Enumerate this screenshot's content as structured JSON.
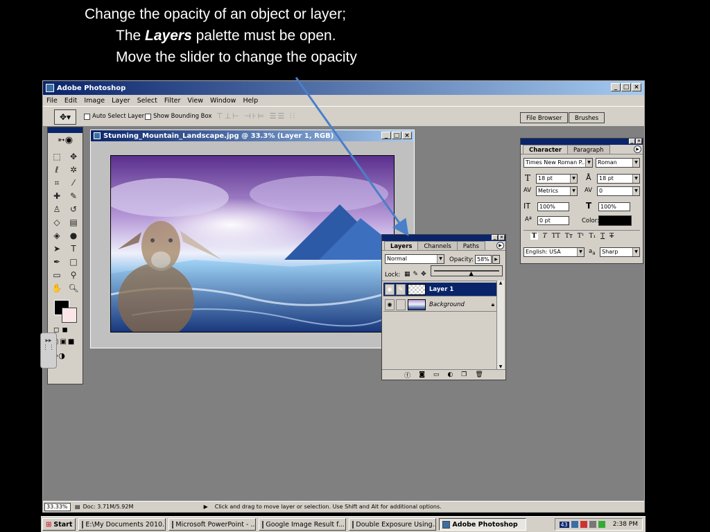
{
  "caption": {
    "line1": "Change the opacity of an object or layer;",
    "line2_prefix": "The ",
    "line2_emphasis": "Layers",
    "line2_suffix": " palette must be open.",
    "line3": "Move the slider to change the opacity"
  },
  "app": {
    "title": "Adobe Photoshop",
    "menu": [
      "File",
      "Edit",
      "Image",
      "Layer",
      "Select",
      "Filter",
      "View",
      "Window",
      "Help"
    ]
  },
  "options_bar": {
    "auto_select": "Auto Select Layer",
    "bounding_box": "Show Bounding Box",
    "tabs": [
      "File Browser",
      "Brushes"
    ]
  },
  "document": {
    "title": "Stunning_Mountain_Landscape.jpg @ 33.3% (Layer 1, RGB)"
  },
  "layers_panel": {
    "tabs": [
      "Layers",
      "Channels",
      "Paths"
    ],
    "blend_mode": "Normal",
    "opacity_label": "Opacity:",
    "opacity_value": "58%",
    "lock_label": "Lock:",
    "layers": [
      {
        "name": "Layer 1",
        "selected": true
      },
      {
        "name": "Background",
        "selected": false
      }
    ]
  },
  "character_panel": {
    "tabs": [
      "Character",
      "Paragraph"
    ],
    "font_family": "Times New Roman P...",
    "font_style": "Roman",
    "size": "18 pt",
    "leading": "18 pt",
    "kerning": "Metrics",
    "tracking": "0",
    "vscale": "100%",
    "hscale": "100%",
    "baseline": "0 pt",
    "color_label": "Color:",
    "language": "English: USA",
    "aa_prefix": "a",
    "antialias": "Sharp"
  },
  "status": {
    "zoom": "33.33%",
    "doc": "Doc: 3.71M/5.92M",
    "hint": "Click and drag to move layer or selection.  Use Shift and Alt for additional options."
  },
  "taskbar": {
    "start": "Start",
    "items": [
      "E:\\My Documents 2010...",
      "Microsoft PowerPoint - ...",
      "Google Image Result f...",
      "Double Exposure Using...",
      "Adobe Photoshop"
    ],
    "tray_badge": "43",
    "clock": "2:38 PM"
  },
  "colors": {
    "accent": "#0a246a",
    "arrow": "#4a7fc9"
  }
}
